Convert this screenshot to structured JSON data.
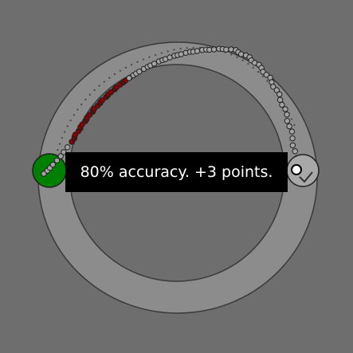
{
  "feedback": {
    "message": "80% accuracy. +3 points.",
    "accuracy_percent": 80,
    "points_awarded": 3
  },
  "colors": {
    "background": "#6e6e6e",
    "track_fill": "#8c8c8c",
    "track_edge": "#3a3a3a",
    "start_target": "#008000",
    "end_target": "#a8a8a8",
    "trace_on_path": "#a3a3a3",
    "trace_off_path": "#8b0000",
    "guide_dots": "#4a4a4a"
  },
  "icons": {
    "end_marker": "cursor-dot-icon",
    "end_tick": "check-tick-icon"
  }
}
